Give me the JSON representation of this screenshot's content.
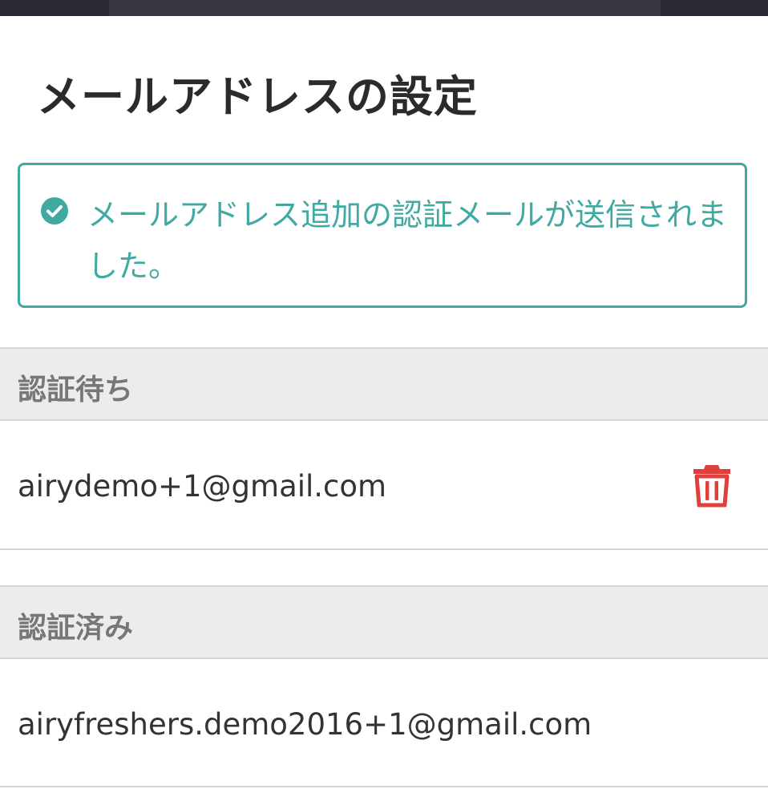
{
  "page": {
    "title": "メールアドレスの設定"
  },
  "alert": {
    "message": "メールアドレス追加の認証メールが送信されました。",
    "icon": "check-circle-icon",
    "color": "#3fa9a2"
  },
  "pending": {
    "header": "認証待ち",
    "emails": [
      {
        "address": "airydemo+1@gmail.com",
        "delete_icon": "trash-icon",
        "delete_color": "#e0403d"
      }
    ]
  },
  "verified": {
    "header": "認証済み",
    "emails": [
      {
        "address": "airyfreshers.demo2016+1@gmail.com"
      }
    ]
  }
}
